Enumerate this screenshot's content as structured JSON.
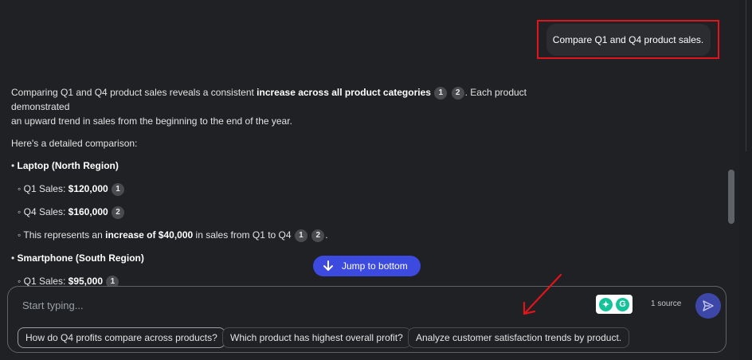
{
  "user_message": "Compare Q1 and Q4 product sales.",
  "response": {
    "intro_part1": "Comparing Q1 and Q4 product sales reveals a consistent ",
    "intro_bold": "increase across all product categories",
    "intro_part2": ". Each product demonstrated",
    "intro_line2": "an upward trend in sales from the beginning to the end of the year.",
    "detail_heading": "Here's a detailed comparison:",
    "laptop_heading": "Laptop (North Region)",
    "laptop_q1_label": "Q1 Sales: ",
    "laptop_q1_value": "$120,000",
    "laptop_q4_label": "Q4 Sales: ",
    "laptop_q4_value": "$160,000",
    "laptop_increase_pre": "This represents an ",
    "laptop_increase_bold": "increase of $40,000",
    "laptop_increase_post": " in sales from Q1 to Q4",
    "smartphone_heading": "Smartphone (South Region)",
    "smartphone_q1_label": "Q1 Sales: ",
    "smartphone_q1_value": "$95,000",
    "citation_1": "1",
    "citation_2": "2",
    "bullet": "•",
    "sub_bullet": "◦",
    "period": "."
  },
  "jump_button": {
    "label": "Jump to bottom",
    "icon": "arrow-down-icon"
  },
  "composer": {
    "placeholder": "Start typing...",
    "source_count": "1 source",
    "send_icon": "send-icon",
    "extension_icons": [
      "grammarly-icon",
      "grammarly-g-icon"
    ]
  },
  "suggestions": [
    "How do Q4 profits compare across products?",
    "Which product has highest overall profit?",
    "Analyze customer satisfaction trends by product."
  ],
  "colors": {
    "background": "#202124",
    "accent": "#3c4ae0",
    "highlight_box": "#e0141a",
    "annotation_arrow": "#e0141a",
    "extension": "#15c39a"
  }
}
